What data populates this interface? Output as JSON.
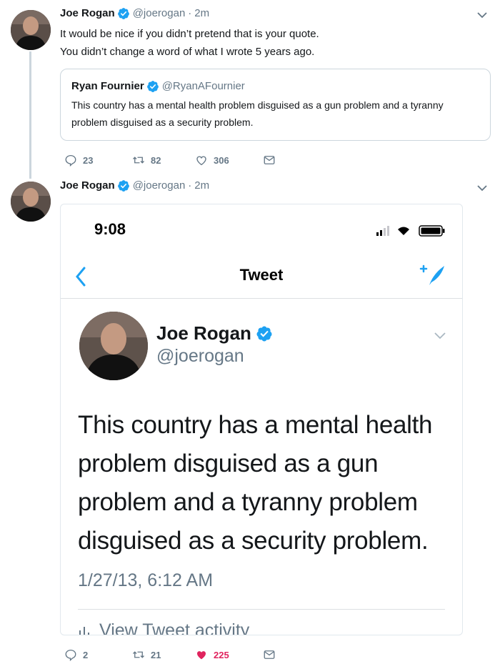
{
  "colors": {
    "verified": "#1da1f2",
    "secondary_text": "#657786",
    "like_active": "#e0245e",
    "border": "#ccd6dd"
  },
  "tweet1": {
    "name": "Joe Rogan",
    "handle": "@joerogan",
    "separator": "·",
    "time": "2m",
    "text_line1": "It would be nice if you didn’t pretend that is your quote.",
    "text_line2": "You didn’t change a word of what I wrote 5 years ago.",
    "quote": {
      "name": "Ryan Fournier",
      "handle": "@RyanAFournier",
      "text": "This country has a mental health problem disguised as a gun problem and a tyranny problem disguised as a security problem."
    },
    "actions": {
      "replies": "23",
      "retweets": "82",
      "likes": "306"
    }
  },
  "tweet2": {
    "name": "Joe Rogan",
    "handle": "@joerogan",
    "separator": "·",
    "time": "2m",
    "screenshot": {
      "status_time": "9:08",
      "nav_title": "Tweet",
      "name": "Joe Rogan",
      "handle": "@joerogan",
      "text": "This country has a mental health problem disguised as a gun problem and a tyranny problem disguised as a security problem.",
      "date": "1/27/13, 6:12 AM",
      "activity": "View Tweet activity"
    },
    "actions": {
      "replies": "2",
      "retweets": "21",
      "likes": "225"
    }
  }
}
